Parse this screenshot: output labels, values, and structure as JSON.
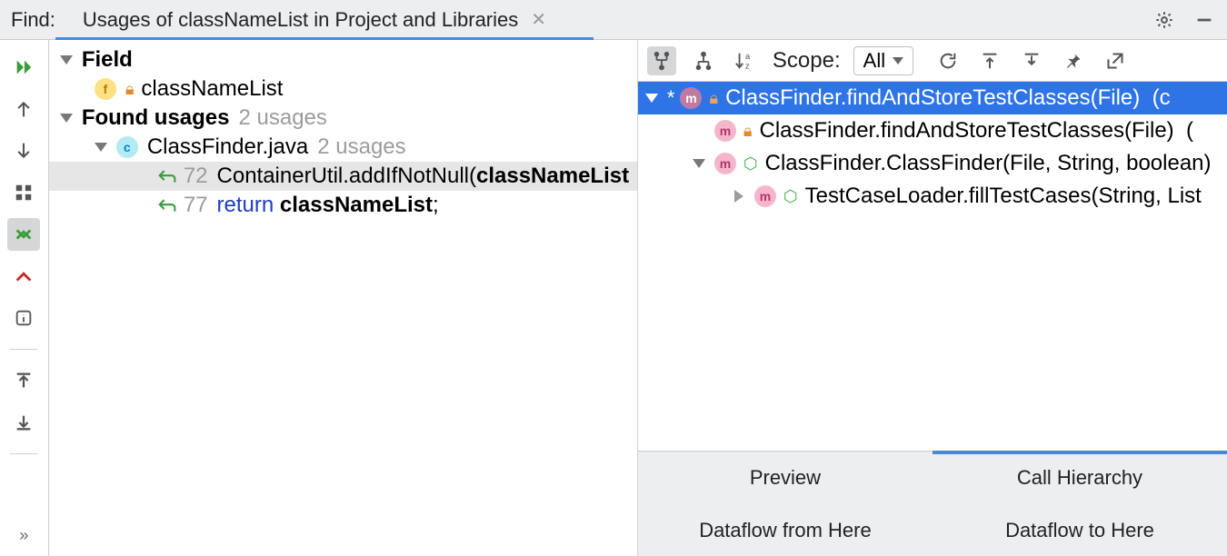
{
  "find": {
    "label": "Find:",
    "tab_title": "Usages of classNameList in Project and Libraries"
  },
  "tree": {
    "field_heading": "Field",
    "field_name": "classNameList",
    "found_heading": "Found usages",
    "found_count": "2 usages",
    "file_name": "ClassFinder.java",
    "file_count": "2 usages",
    "usages": [
      {
        "line": "72",
        "code_prefix": "ContainerUtil.addIfNotNull(",
        "code_bold": "classNameList",
        "code_suffix": ""
      },
      {
        "line": "77",
        "keyword": "return",
        "code_bold": "classNameList",
        "code_suffix": ";"
      }
    ]
  },
  "scope": {
    "label": "Scope:",
    "value": "All"
  },
  "hierarchy": {
    "rows": [
      {
        "level": 0,
        "modified": "*",
        "access": "lock",
        "text": "ClassFinder.findAndStoreTestClasses(File)",
        "trail": "(c",
        "selected": true,
        "arrow": "down"
      },
      {
        "level": 1,
        "modified": "",
        "access": "lock",
        "text": "ClassFinder.findAndStoreTestClasses(File)",
        "trail": "(",
        "selected": false,
        "arrow": ""
      },
      {
        "level": 1,
        "modified": "",
        "access": "pub",
        "text": "ClassFinder.ClassFinder(File, String, boolean)",
        "trail": "",
        "selected": false,
        "arrow": "down"
      },
      {
        "level": 2,
        "modified": "",
        "access": "pub",
        "text": "TestCaseLoader.fillTestCases(String, List",
        "trail": "",
        "selected": false,
        "arrow": "right"
      }
    ]
  },
  "bottom_tabs": {
    "preview": "Preview",
    "call_hierarchy": "Call Hierarchy",
    "dataflow_from": "Dataflow from Here",
    "dataflow_to": "Dataflow to Here"
  }
}
